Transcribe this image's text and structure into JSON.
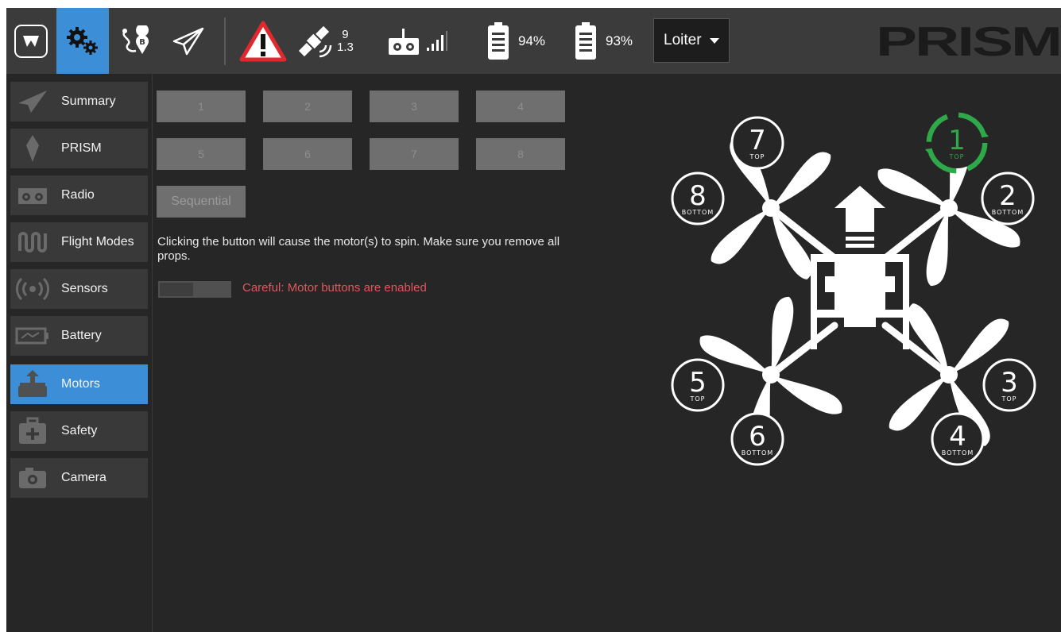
{
  "toolbar": {
    "gps": {
      "satellites": "9",
      "hdop": "1.3"
    },
    "battery1": {
      "percent": "94%"
    },
    "battery2": {
      "percent": "93%"
    },
    "flight_mode": {
      "selected": "Loiter"
    },
    "brand": "PRISM"
  },
  "sidebar": {
    "items": [
      {
        "label": "Summary",
        "icon": "paper-plane-icon"
      },
      {
        "label": "PRISM",
        "icon": "prism-crystal-icon"
      },
      {
        "label": "Radio",
        "icon": "radio-controller-icon"
      },
      {
        "label": "Flight Modes",
        "icon": "flight-modes-wave-icon"
      },
      {
        "label": "Sensors",
        "icon": "sensor-signal-icon"
      },
      {
        "label": "Battery",
        "icon": "battery-icon"
      },
      {
        "label": "Motors",
        "icon": "motor-icon",
        "active": true
      },
      {
        "label": "Safety",
        "icon": "first-aid-kit-icon"
      },
      {
        "label": "Camera",
        "icon": "camera-icon"
      }
    ]
  },
  "motors": {
    "buttons": [
      "1",
      "2",
      "3",
      "4",
      "5",
      "6",
      "7",
      "8"
    ],
    "sequential_label": "Sequential",
    "warning": "Clicking the button will cause the motor(s) to spin. Make sure you remove all props.",
    "careful_text": "Careful: Motor buttons are enabled",
    "enable_toggle": "off"
  },
  "diagram": {
    "motors": [
      {
        "number": "1",
        "position": "TOP",
        "highlighted": true
      },
      {
        "number": "2",
        "position": "BOTTOM"
      },
      {
        "number": "3",
        "position": "TOP"
      },
      {
        "number": "4",
        "position": "BOTTOM"
      },
      {
        "number": "5",
        "position": "TOP"
      },
      {
        "number": "6",
        "position": "BOTTOM"
      },
      {
        "number": "7",
        "position": "TOP"
      },
      {
        "number": "8",
        "position": "BOTTOM"
      }
    ]
  },
  "colors": {
    "accent": "#3c8fd6",
    "warning_red": "#e0575b",
    "highlight_green": "#2fa84a",
    "toolbar_bg": "#3b3b3b",
    "panel_bg": "#262626"
  }
}
